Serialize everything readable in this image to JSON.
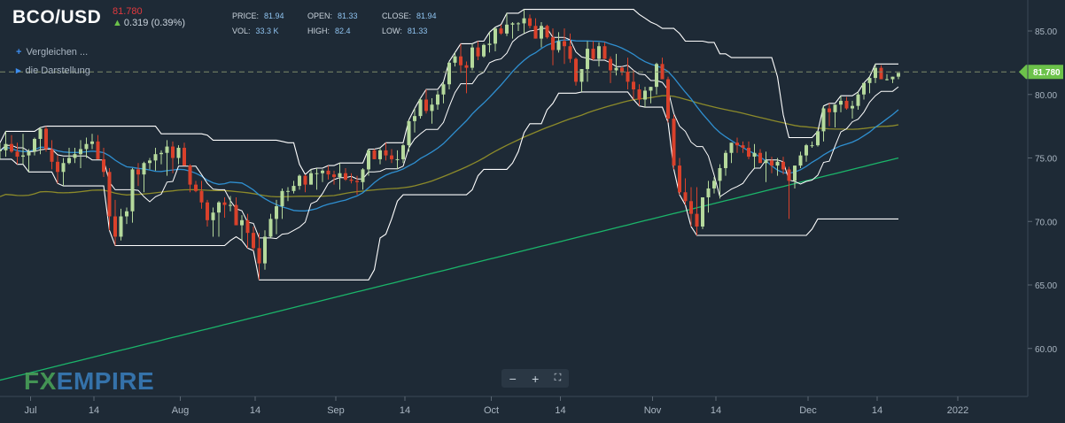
{
  "header": {
    "symbol": "BCO/USD",
    "last_price": "81.780",
    "change": "0.319 (0.39%)",
    "stats": [
      {
        "label": "PRICE:",
        "value": "81.94"
      },
      {
        "label": "OPEN:",
        "value": "81.33"
      },
      {
        "label": "CLOSE:",
        "value": "81.94"
      },
      {
        "label": "VOL:",
        "value": "33.3 K"
      },
      {
        "label": "HIGH:",
        "value": "82.4"
      },
      {
        "label": "LOW:",
        "value": "81.33"
      }
    ]
  },
  "menu": {
    "compare_label": "Vergleichen ...",
    "display_label": "die Darstellung"
  },
  "zoom": {
    "minus": "−",
    "plus": "+",
    "fullscreen": "⛶"
  },
  "logo": {
    "fx": "FX",
    "empire": "EMPIRE"
  },
  "colors": {
    "background": "#1e2a36",
    "up": "#b5d99c",
    "down": "#d9412b",
    "envelope": "#ffffff",
    "ma_blue": "#2f8fd0",
    "ma_olive": "#8c8a2a",
    "ma_green": "#1bb56a",
    "price_tag": "#6cc24a"
  },
  "chart_data": {
    "type": "candlestick",
    "x_ticks": [
      "Jul",
      "14",
      "Aug",
      "14",
      "Sep",
      "14",
      "Oct",
      "14",
      "Nov",
      "14",
      "Dec",
      "14",
      "2022"
    ],
    "y_ticks": [
      "85.00",
      "80.00",
      "75.00",
      "70.00",
      "65.00",
      "60.00"
    ],
    "ylim": [
      56.8,
      88
    ],
    "current_price": "81.780",
    "current_price_value": 81.78,
    "ohlc": [
      [
        75.6,
        76.2,
        74.9,
        75.6
      ],
      [
        75.6,
        77.1,
        75.1,
        76.1
      ],
      [
        76.1,
        76.8,
        75.4,
        75.5
      ],
      [
        75.5,
        76.2,
        74.5,
        75.1
      ],
      [
        75.1,
        76.9,
        74.5,
        75.2
      ],
      [
        75.2,
        75.7,
        73.9,
        75.5
      ],
      [
        75.5,
        76.6,
        75.2,
        76.5
      ],
      [
        76.5,
        77.4,
        75.3,
        77.3
      ],
      [
        77.3,
        77.5,
        75.5,
        75.7
      ],
      [
        75.7,
        76.4,
        74.1,
        74.7
      ],
      [
        74.7,
        75.2,
        73.0,
        73.9
      ],
      [
        73.9,
        75.0,
        72.8,
        74.6
      ],
      [
        74.6,
        75.8,
        74.5,
        75.0
      ],
      [
        75.0,
        75.8,
        74.6,
        75.3
      ],
      [
        75.3,
        76.4,
        74.2,
        75.7
      ],
      [
        75.7,
        76.6,
        75.0,
        76.1
      ],
      [
        76.1,
        76.9,
        75.7,
        76.3
      ],
      [
        76.3,
        76.8,
        74.9,
        74.9
      ],
      [
        74.9,
        75.8,
        73.5,
        73.9
      ],
      [
        73.9,
        74.2,
        69.3,
        70.4
      ],
      [
        70.4,
        71.7,
        68.1,
        68.8
      ],
      [
        68.8,
        71.0,
        68.5,
        70.4
      ],
      [
        70.4,
        71.1,
        69.8,
        70.8
      ],
      [
        70.8,
        74.2,
        69.9,
        74.1
      ],
      [
        74.1,
        74.6,
        72.8,
        73.7
      ],
      [
        73.7,
        74.7,
        72.3,
        74.6
      ],
      [
        74.6,
        75.0,
        74.1,
        74.8
      ],
      [
        74.8,
        75.8,
        74.0,
        75.3
      ],
      [
        75.3,
        75.6,
        74.5,
        75.4
      ],
      [
        75.4,
        76.4,
        73.6,
        75.9
      ],
      [
        75.9,
        76.3,
        73.8,
        75.0
      ],
      [
        75.0,
        76.0,
        74.5,
        75.8
      ],
      [
        75.8,
        76.2,
        74.4,
        74.4
      ],
      [
        74.4,
        74.5,
        72.3,
        72.9
      ],
      [
        72.9,
        73.2,
        72.3,
        72.4
      ],
      [
        72.4,
        73.2,
        71.0,
        71.5
      ],
      [
        71.5,
        71.7,
        69.6,
        70.1
      ],
      [
        70.1,
        71.1,
        68.8,
        70.7
      ],
      [
        70.7,
        71.6,
        68.8,
        71.5
      ],
      [
        71.5,
        71.9,
        70.3,
        71.3
      ],
      [
        71.3,
        72.0,
        70.8,
        71.3
      ],
      [
        71.3,
        71.9,
        69.7,
        69.7
      ],
      [
        69.7,
        70.5,
        68.5,
        70.1
      ],
      [
        70.1,
        70.6,
        67.9,
        69.1
      ],
      [
        69.1,
        69.6,
        67.7,
        67.9
      ],
      [
        67.9,
        69.1,
        65.4,
        66.7
      ],
      [
        66.7,
        69.3,
        66.2,
        68.8
      ],
      [
        68.8,
        70.6,
        68.7,
        70.2
      ],
      [
        70.2,
        71.7,
        69.0,
        71.2
      ],
      [
        71.2,
        72.6,
        70.2,
        72.4
      ],
      [
        72.4,
        72.7,
        71.6,
        72.4
      ],
      [
        72.4,
        73.2,
        72.2,
        72.8
      ],
      [
        72.8,
        73.7,
        72.5,
        73.6
      ],
      [
        73.6,
        73.7,
        72.3,
        72.9
      ],
      [
        72.9,
        74.1,
        72.9,
        73.8
      ],
      [
        73.8,
        74.2,
        72.5,
        73.8
      ],
      [
        73.8,
        74.1,
        73.1,
        74.0
      ],
      [
        74.0,
        74.4,
        73.3,
        73.7
      ],
      [
        73.7,
        74.0,
        72.9,
        73.5
      ],
      [
        73.5,
        74.6,
        72.5,
        73.8
      ],
      [
        73.8,
        74.2,
        73.2,
        73.3
      ],
      [
        73.3,
        73.8,
        73.0,
        73.2
      ],
      [
        73.2,
        73.6,
        72.1,
        73.1
      ],
      [
        73.1,
        74.2,
        72.5,
        74.1
      ],
      [
        74.1,
        75.7,
        73.6,
        75.6
      ],
      [
        75.6,
        75.7,
        74.9,
        74.9
      ],
      [
        74.9,
        75.8,
        74.5,
        75.6
      ],
      [
        75.6,
        76.2,
        74.8,
        75.2
      ],
      [
        75.2,
        75.7,
        74.6,
        74.9
      ],
      [
        74.9,
        75.6,
        74.1,
        74.9
      ],
      [
        74.9,
        76.1,
        74.6,
        76.0
      ],
      [
        76.0,
        78.0,
        75.5,
        77.9
      ],
      [
        77.9,
        78.9,
        77.0,
        78.3
      ],
      [
        78.3,
        79.7,
        78.1,
        79.6
      ],
      [
        79.6,
        80.4,
        78.5,
        78.7
      ],
      [
        78.7,
        79.7,
        77.7,
        79.2
      ],
      [
        79.2,
        80.3,
        78.8,
        80.0
      ],
      [
        80.0,
        81.0,
        79.3,
        80.8
      ],
      [
        80.8,
        82.6,
        80.4,
        82.5
      ],
      [
        82.5,
        83.3,
        82.2,
        83.0
      ],
      [
        83.0,
        84.0,
        81.7,
        82.3
      ],
      [
        82.3,
        82.6,
        80.1,
        82.1
      ],
      [
        82.1,
        84.0,
        81.9,
        83.7
      ],
      [
        83.7,
        84.2,
        82.7,
        83.0
      ],
      [
        83.0,
        84.0,
        82.9,
        83.9
      ],
      [
        83.9,
        84.9,
        83.3,
        84.0
      ],
      [
        84.0,
        85.3,
        83.4,
        85.2
      ],
      [
        85.2,
        85.5,
        84.7,
        84.8
      ],
      [
        84.8,
        86.4,
        84.6,
        85.5
      ],
      [
        85.5,
        85.7,
        84.4,
        85.6
      ],
      [
        85.6,
        85.7,
        85.0,
        85.6
      ],
      [
        85.6,
        86.7,
        84.8,
        86.0
      ],
      [
        86.0,
        86.3,
        85.2,
        85.4
      ],
      [
        85.4,
        86.0,
        84.4,
        84.4
      ],
      [
        84.4,
        85.7,
        83.7,
        85.4
      ],
      [
        85.4,
        85.5,
        84.4,
        84.5
      ],
      [
        84.5,
        85.2,
        82.3,
        83.5
      ],
      [
        83.5,
        84.9,
        83.3,
        84.2
      ],
      [
        84.2,
        85.2,
        82.4,
        83.8
      ],
      [
        83.8,
        84.8,
        82.5,
        82.8
      ],
      [
        82.8,
        82.9,
        80.7,
        81.0
      ],
      [
        81.0,
        82.0,
        80.2,
        82.0
      ],
      [
        82.0,
        84.2,
        81.0,
        83.6
      ],
      [
        83.6,
        84.2,
        82.7,
        82.8
      ],
      [
        82.8,
        84.1,
        82.2,
        83.8
      ],
      [
        83.8,
        84.1,
        82.8,
        82.8
      ],
      [
        82.8,
        83.0,
        80.9,
        81.9
      ],
      [
        81.9,
        83.2,
        81.5,
        82.1
      ],
      [
        82.1,
        82.2,
        81.5,
        81.8
      ],
      [
        81.8,
        82.9,
        80.4,
        81.0
      ],
      [
        81.0,
        81.9,
        79.6,
        80.4
      ],
      [
        80.4,
        80.8,
        79.1,
        79.6
      ],
      [
        79.6,
        80.6,
        79.0,
        80.3
      ],
      [
        80.3,
        80.6,
        79.3,
        80.6
      ],
      [
        80.6,
        82.5,
        80.0,
        82.4
      ],
      [
        82.4,
        82.9,
        81.2,
        81.2
      ],
      [
        81.2,
        81.4,
        77.8,
        78.1
      ],
      [
        78.1,
        78.4,
        74.1,
        74.4
      ],
      [
        74.4,
        75.0,
        72.1,
        72.3
      ],
      [
        72.3,
        73.4,
        71.3,
        71.6
      ],
      [
        71.6,
        72.7,
        69.6,
        70.6
      ],
      [
        70.6,
        72.7,
        68.9,
        69.6
      ],
      [
        69.6,
        71.9,
        69.4,
        71.9
      ],
      [
        71.9,
        73.2,
        70.7,
        72.6
      ],
      [
        72.6,
        73.5,
        72.2,
        73.2
      ],
      [
        73.2,
        74.5,
        71.8,
        74.2
      ],
      [
        74.2,
        75.6,
        73.6,
        75.4
      ],
      [
        75.4,
        76.2,
        74.6,
        76.2
      ],
      [
        76.2,
        76.6,
        75.4,
        76.0
      ],
      [
        76.0,
        76.3,
        75.4,
        75.8
      ],
      [
        75.8,
        76.3,
        74.9,
        75.1
      ],
      [
        75.1,
        76.1,
        74.2,
        75.4
      ],
      [
        75.4,
        75.7,
        74.6,
        74.6
      ],
      [
        74.6,
        75.5,
        73.1,
        74.8
      ],
      [
        74.8,
        75.1,
        73.8,
        74.4
      ],
      [
        74.4,
        75.0,
        73.6,
        74.7
      ],
      [
        74.7,
        75.1,
        73.7,
        74.1
      ],
      [
        74.1,
        74.3,
        70.2,
        73.2
      ],
      [
        73.2,
        74.4,
        72.6,
        74.4
      ],
      [
        74.4,
        75.5,
        74.2,
        75.2
      ],
      [
        75.2,
        76.1,
        74.7,
        76.0
      ],
      [
        76.0,
        76.3,
        75.8,
        76.0
      ],
      [
        76.0,
        77.1,
        75.9,
        77.1
      ],
      [
        77.1,
        79.1,
        76.3,
        78.9
      ],
      [
        78.9,
        79.3,
        77.5,
        78.6
      ],
      [
        78.6,
        79.2,
        77.4,
        79.2
      ],
      [
        79.2,
        79.9,
        78.6,
        79.5
      ],
      [
        79.5,
        79.8,
        78.8,
        78.9
      ],
      [
        78.9,
        79.5,
        78.1,
        79.1
      ],
      [
        79.1,
        80.2,
        78.8,
        80.0
      ],
      [
        80.0,
        80.9,
        79.6,
        80.9
      ],
      [
        80.9,
        81.4,
        80.1,
        81.3
      ],
      [
        81.3,
        82.4,
        80.9,
        82.1
      ],
      [
        82.1,
        82.3,
        81.2,
        81.2
      ],
      [
        81.2,
        81.6,
        81.1,
        81.2
      ],
      [
        81.2,
        81.4,
        80.9,
        81.4
      ],
      [
        81.4,
        81.7,
        81.2,
        81.7
      ]
    ]
  }
}
